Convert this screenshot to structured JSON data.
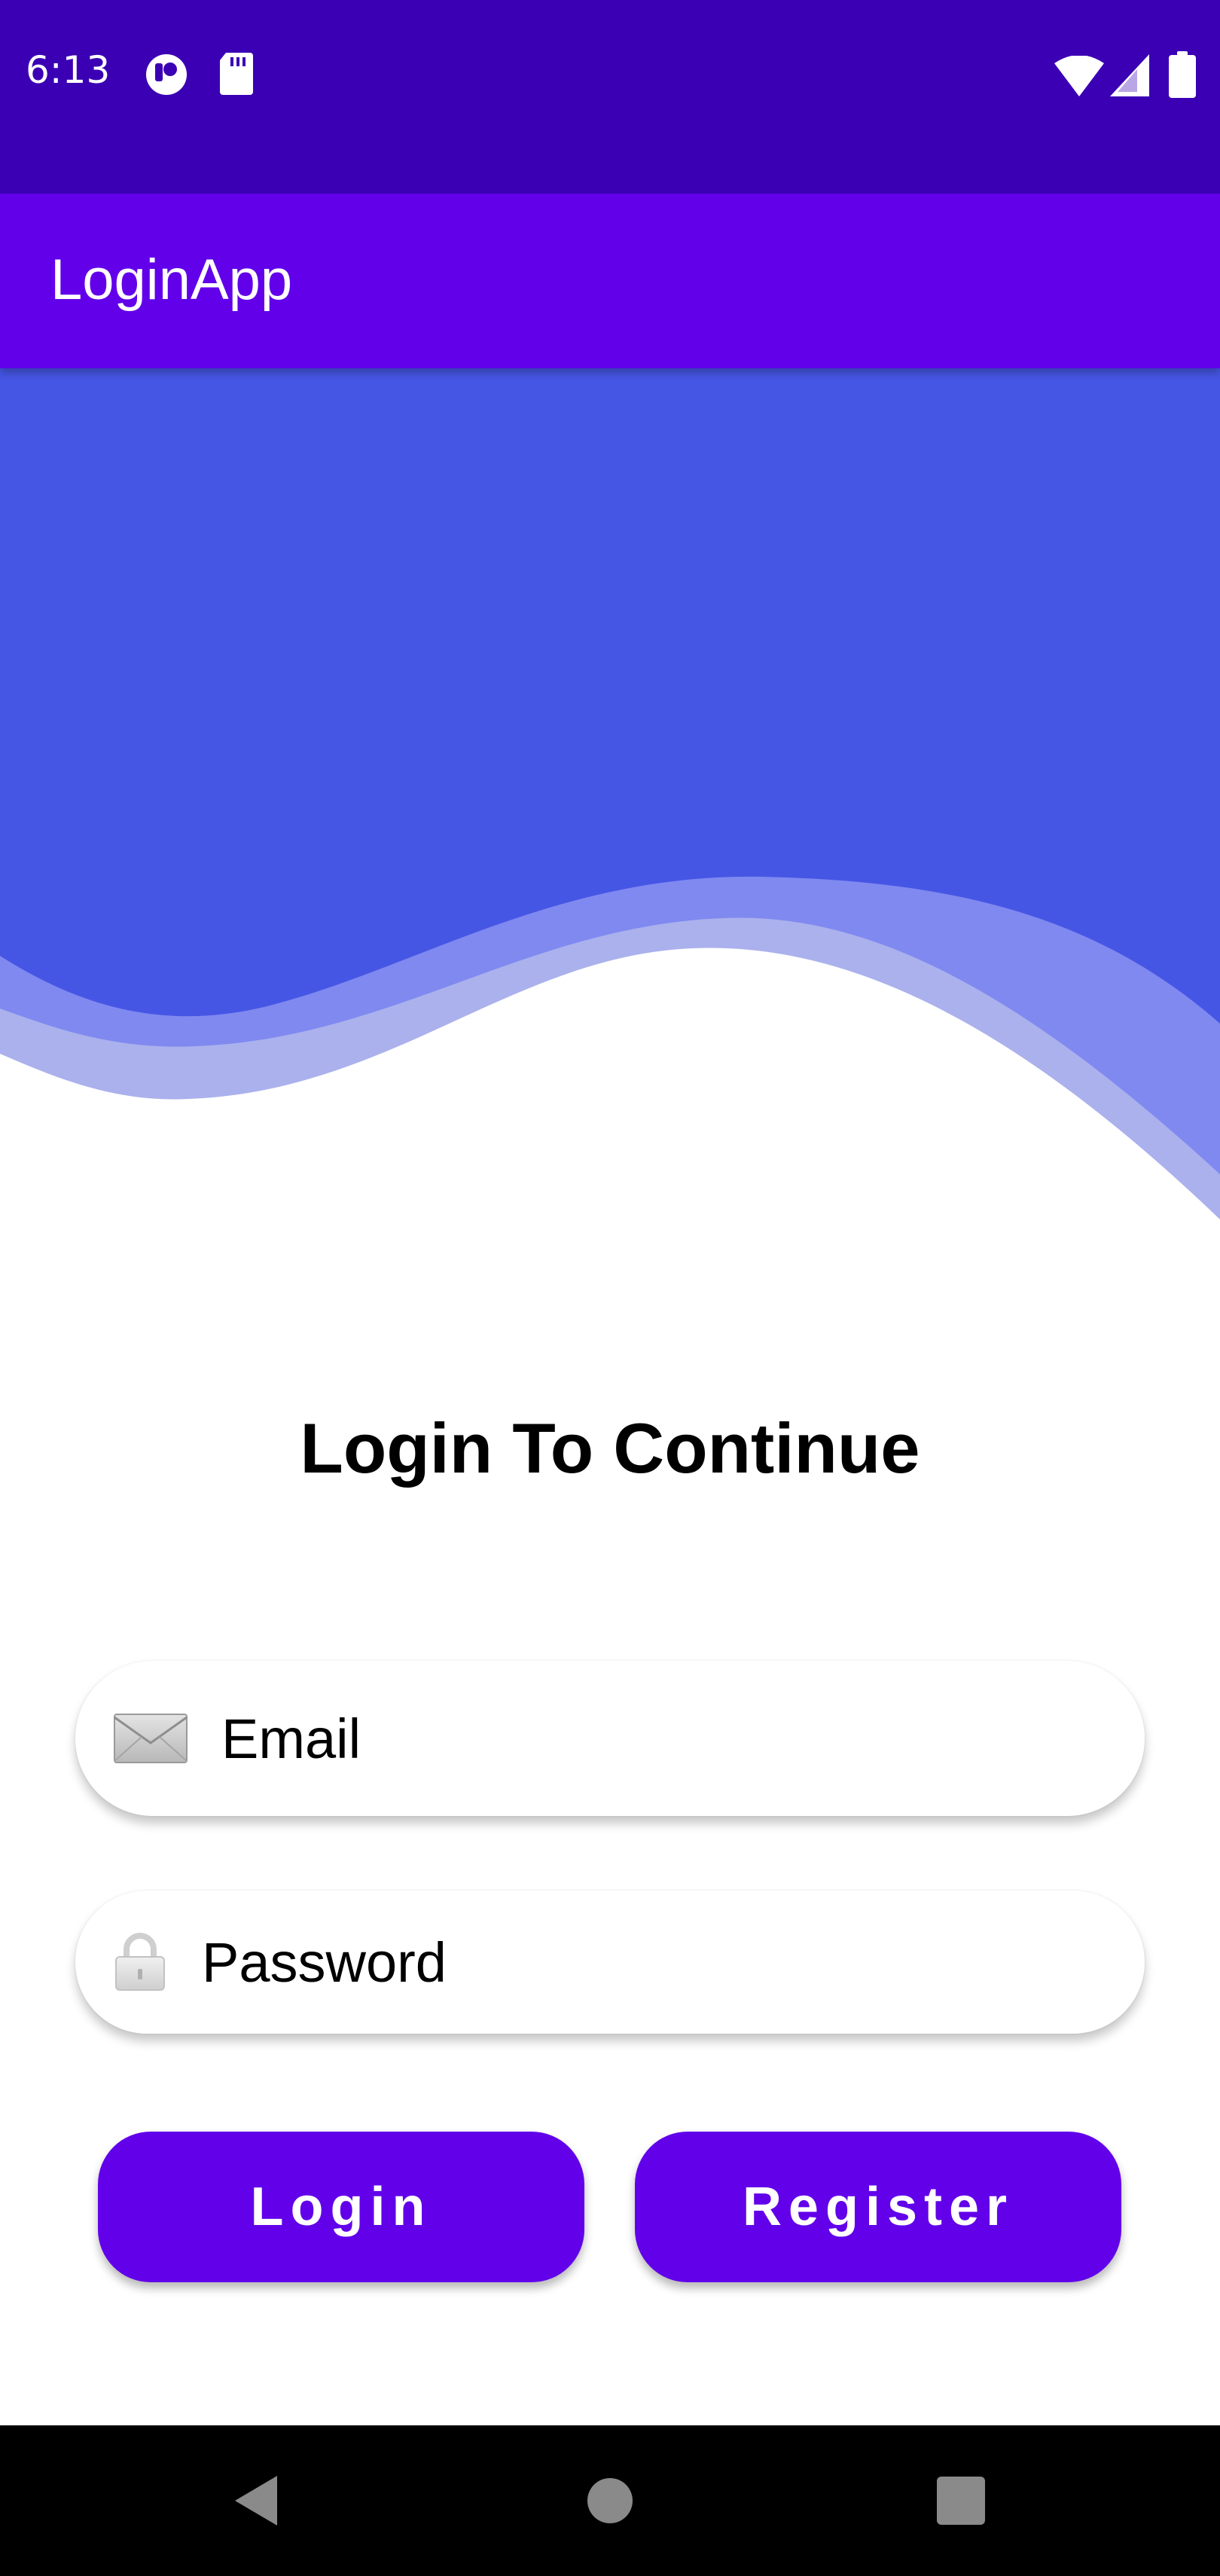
{
  "status_bar": {
    "time": "6:13",
    "left_icons": [
      "record-icon",
      "sd-card-icon"
    ],
    "right_icons": [
      "wifi-icon",
      "cellular-signal-icon",
      "battery-icon"
    ]
  },
  "app_bar": {
    "title": "LoginApp"
  },
  "login_form": {
    "heading": "Login To Continue",
    "email": {
      "placeholder": "Email",
      "value": "",
      "icon": "envelope-icon"
    },
    "password": {
      "placeholder": "Password",
      "value": "",
      "icon": "lock-icon"
    },
    "login_button": "Login",
    "register_button": "Register"
  },
  "nav_bar": {
    "buttons": [
      "back-icon",
      "home-icon",
      "recents-icon"
    ]
  },
  "colors": {
    "status_bar": "#3b00b4",
    "app_bar": "#6200ea",
    "wave_primary": "#4656e4",
    "wave_secondary": "#8089f0",
    "wave_tertiary": "#aab1ec",
    "button": "#6200ea",
    "nav_bar": "#000000"
  }
}
